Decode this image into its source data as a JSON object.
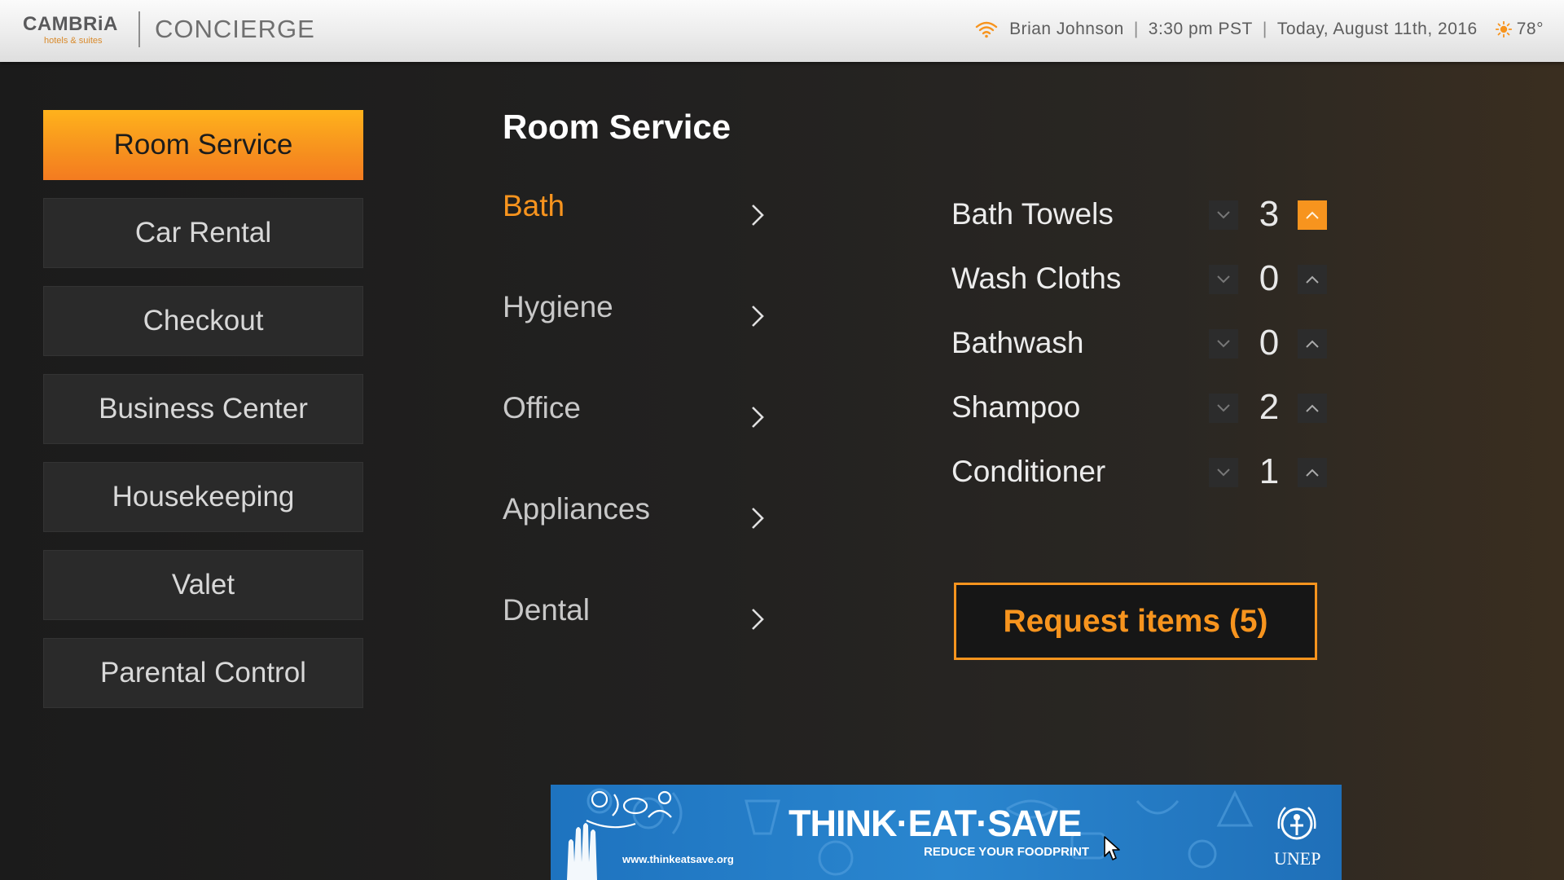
{
  "header": {
    "logo_main": "CAMBRiA",
    "logo_sub": "hotels & suites",
    "app_title": "CONCIERGE",
    "user": "Brian Johnson",
    "time": "3:30 pm PST",
    "date": "Today, August 11th, 2016",
    "temperature": "78°",
    "icons": [
      "wifi-icon",
      "sun-icon"
    ]
  },
  "menu": {
    "items": [
      {
        "label": "Room Service",
        "active": true
      },
      {
        "label": "Car Rental",
        "active": false
      },
      {
        "label": "Checkout",
        "active": false
      },
      {
        "label": "Business Center",
        "active": false
      },
      {
        "label": "Housekeeping",
        "active": false
      },
      {
        "label": "Valet",
        "active": false
      },
      {
        "label": "Parental Control",
        "active": false
      }
    ]
  },
  "categories": {
    "title": "Room Service",
    "items": [
      {
        "label": "Bath",
        "active": true
      },
      {
        "label": "Hygiene",
        "active": false
      },
      {
        "label": "Office",
        "active": false
      },
      {
        "label": "Appliances",
        "active": false
      },
      {
        "label": "Dental",
        "active": false
      }
    ]
  },
  "items": {
    "rows": [
      {
        "name": "Bath Towels",
        "qty": "3"
      },
      {
        "name": "Wash Cloths",
        "qty": "0"
      },
      {
        "name": "Bathwash",
        "qty": "0"
      },
      {
        "name": "Shampoo",
        "qty": "2"
      },
      {
        "name": "Conditioner",
        "qty": "1"
      }
    ]
  },
  "request_button": {
    "label": "Request items (5)"
  },
  "banner": {
    "headline": "THINK·EAT·SAVE",
    "subline": "REDUCE YOUR FOODPRINT",
    "url": "www.thinkeatsave.org",
    "org": "UNEP"
  },
  "colors": {
    "accent": "#f7941e",
    "background": "#1c1c1c",
    "banner_blue": "#2a86cf"
  }
}
